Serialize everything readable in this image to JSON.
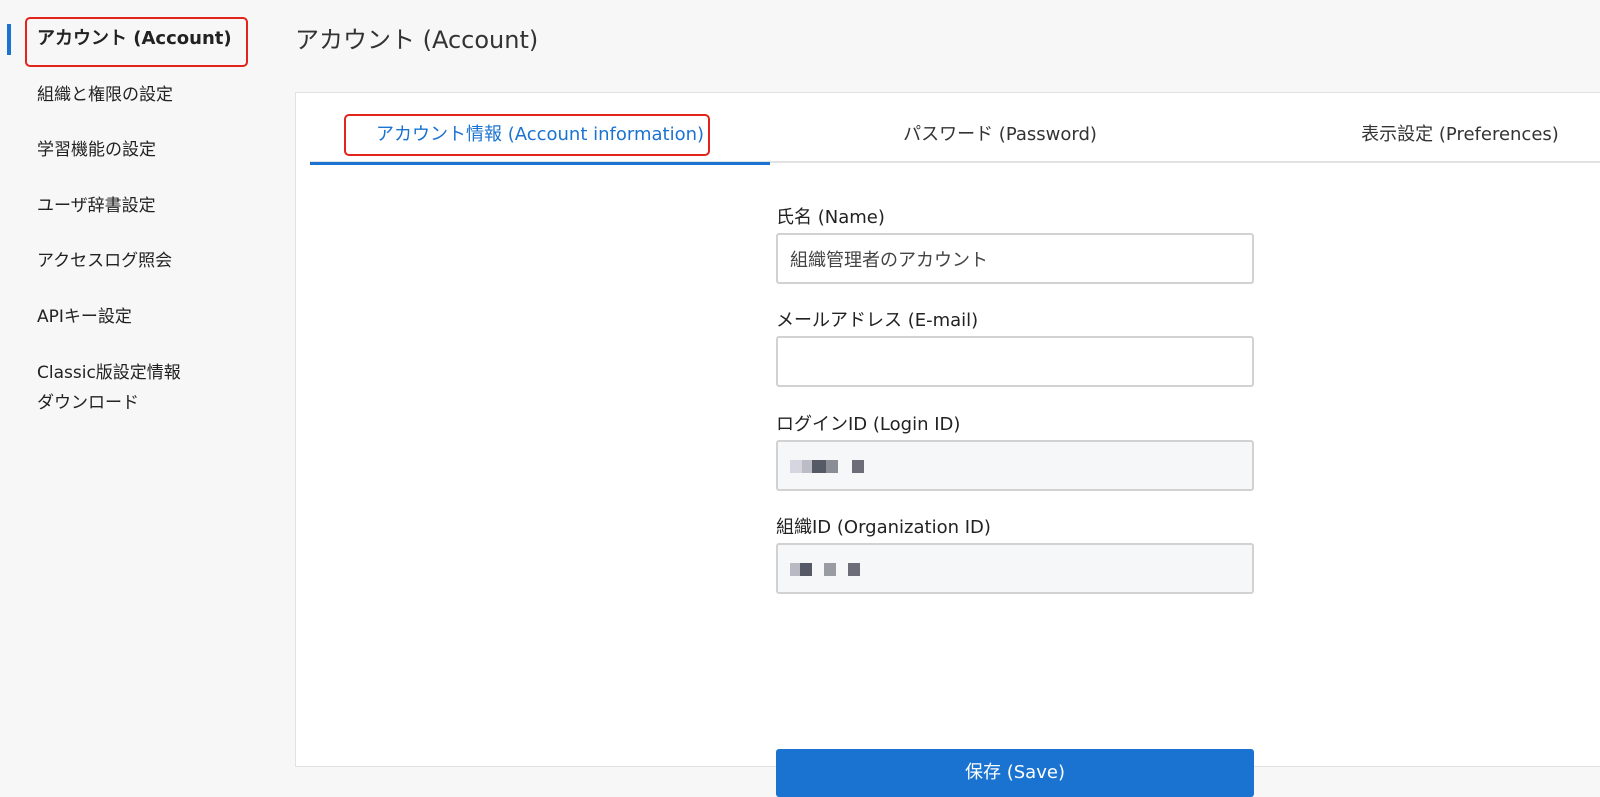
{
  "sidebar": {
    "items": [
      {
        "label": "アカウント (Account)"
      },
      {
        "label": "組織と権限の設定"
      },
      {
        "label": "学習機能の設定"
      },
      {
        "label": "ユーザ辞書設定"
      },
      {
        "label": "アクセスログ照会"
      },
      {
        "label": "APIキー設定"
      },
      {
        "label_line1": "Classic版設定情報",
        "label_line2": "ダウンロード"
      }
    ]
  },
  "header": {
    "title": "アカウント (Account)"
  },
  "tabs": [
    {
      "label": "アカウント情報 (Account information)"
    },
    {
      "label": "パスワード (Password)"
    },
    {
      "label": "表示設定 (Preferences)"
    }
  ],
  "form": {
    "name": {
      "label": "氏名 (Name)",
      "value": "組織管理者のアカウント"
    },
    "email": {
      "label": "メールアドレス (E-mail)",
      "value": ""
    },
    "login_id": {
      "label": "ログインID (Login ID)"
    },
    "org_id": {
      "label": "組織ID (Organization ID)"
    },
    "save_label": "保存 (Save)"
  },
  "colors": {
    "accent": "#1a73d1",
    "highlight": "#e4231a"
  }
}
